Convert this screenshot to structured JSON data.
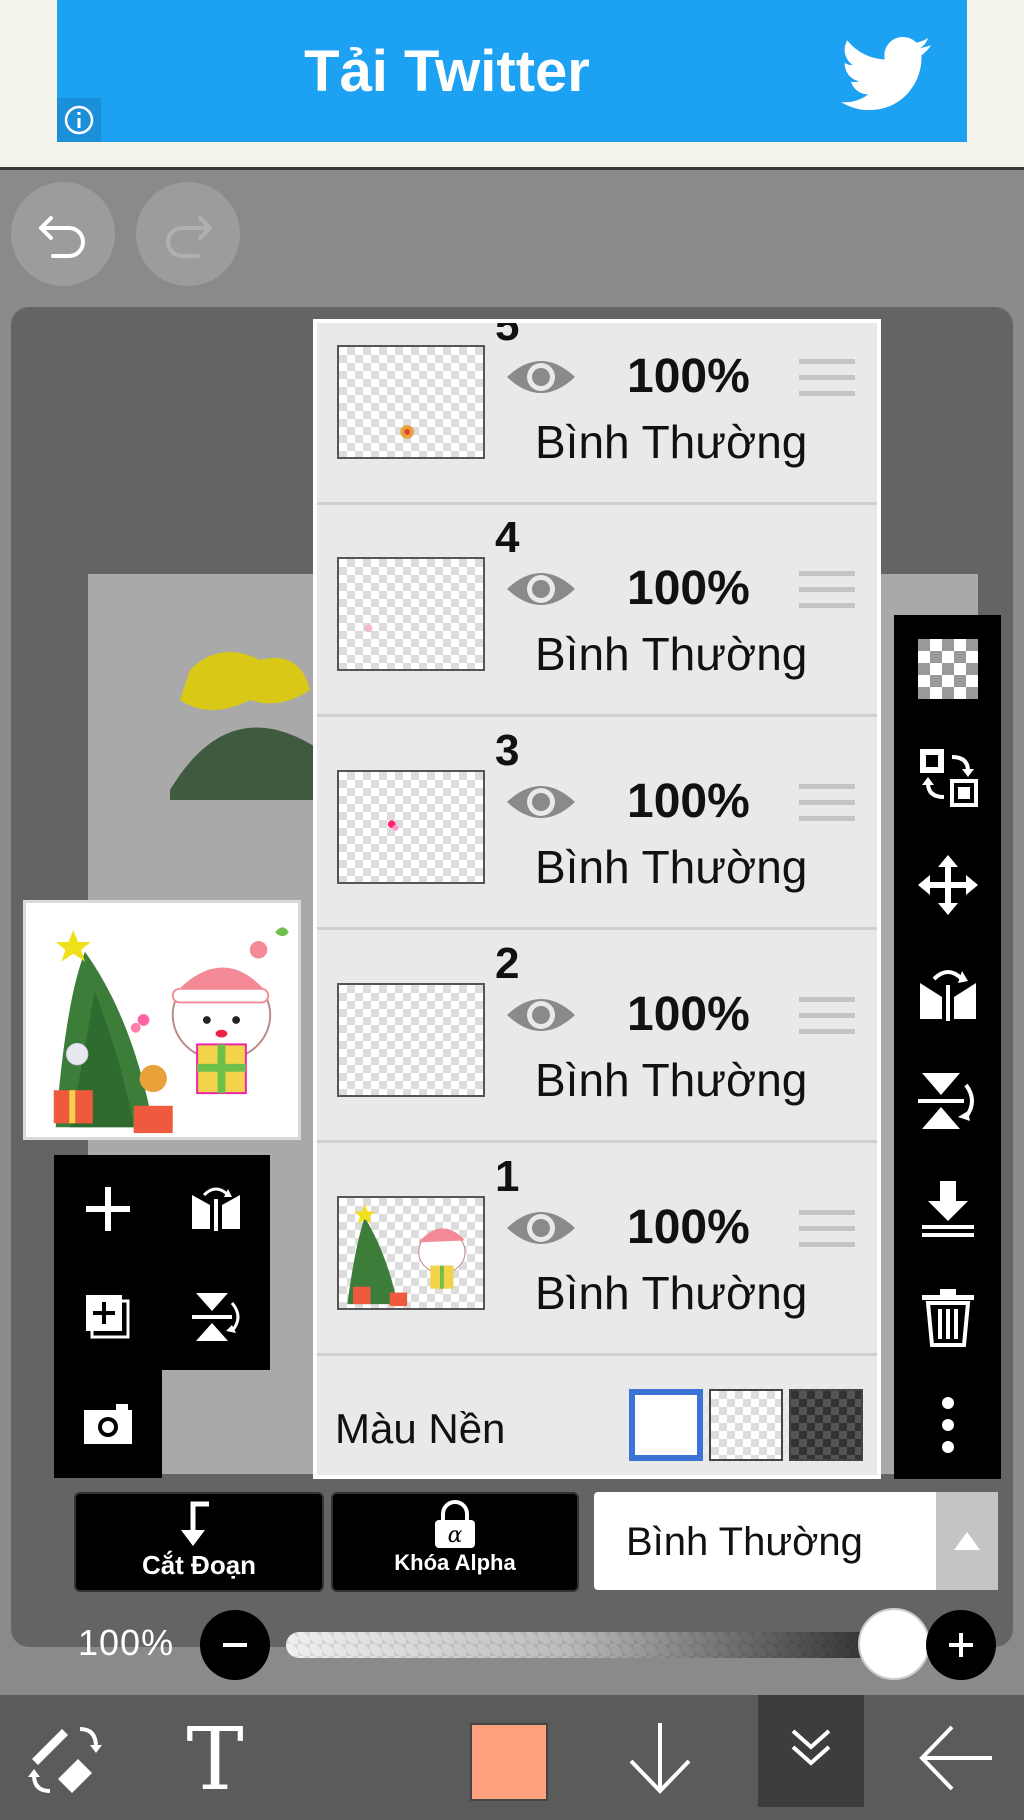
{
  "ad": {
    "text": "Tải Twitter",
    "brand_color": "#1da1f2"
  },
  "history": {
    "undo_icon": "undo-icon",
    "redo_icon": "redo-icon"
  },
  "layers": [
    {
      "number": "5",
      "opacity": "100%",
      "blend_mode": "Bình Thường",
      "visible": true
    },
    {
      "number": "4",
      "opacity": "100%",
      "blend_mode": "Bình Thường",
      "visible": true
    },
    {
      "number": "3",
      "opacity": "100%",
      "blend_mode": "Bình Thường",
      "visible": true
    },
    {
      "number": "2",
      "opacity": "100%",
      "blend_mode": "Bình Thường",
      "visible": true
    },
    {
      "number": "1",
      "opacity": "100%",
      "blend_mode": "Bình Thường",
      "visible": true
    }
  ],
  "background": {
    "label": "Màu Nền",
    "options": [
      "white",
      "transparent",
      "dark-checker"
    ],
    "selected": "white",
    "selected_color": "#3b74d6"
  },
  "layer_actions": {
    "clip_label": "Cắt Đoạn",
    "alpha_lock_label": "Khóa Alpha",
    "blend_mode_value": "Bình Thường"
  },
  "opacity": {
    "label": "100%",
    "value": 100
  },
  "toolbar": {
    "current_color": "#ffa07f",
    "right_tools": [
      "transparent-bg-icon",
      "swap-layer-icon",
      "move-icon",
      "flip-horizontal-icon",
      "flip-vertical-icon",
      "merge-down-icon",
      "trash-icon",
      "more-vert-icon"
    ],
    "left_tools": [
      "add-layer-icon",
      "flip-layer-horizontal-icon",
      "duplicate-layer-icon",
      "flip-layer-vertical-icon",
      "camera-icon"
    ],
    "bottom_tools": [
      "brush-eraser-switch-icon",
      "text-icon",
      "color-swatch",
      "download-icon",
      "layers-icon",
      "back-arrow-icon"
    ]
  }
}
